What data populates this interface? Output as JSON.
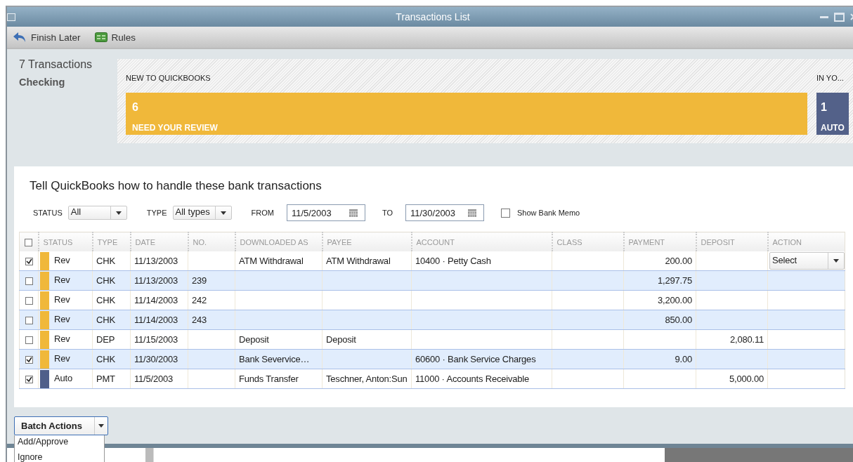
{
  "window": {
    "title": "Transactions List"
  },
  "toolbar": [
    {
      "kind": "back",
      "label": "Finish Later"
    },
    {
      "kind": "rules",
      "label": "Rules"
    }
  ],
  "summary": {
    "count": "7 Transactions",
    "account": "Checking",
    "new_heading": "NEW TO QUICKBOOKS",
    "review_count": "6",
    "review_label": "NEED YOUR REVIEW",
    "in_heading": "IN YO...",
    "auto_count": "1",
    "auto_label": "AUTO"
  },
  "panel": {
    "heading": "Tell QuickBooks how to handle these bank transactions",
    "filters": {
      "status_label": "STATUS",
      "status_value": "All",
      "type_label": "TYPE",
      "type_value": "All types",
      "from_label": "FROM",
      "from_value": "11/5/2003",
      "to_label": "TO",
      "to_value": "11/30/2003",
      "memo_label": "Show Bank Memo",
      "memo_checked": false
    }
  },
  "table": {
    "all_checked": false,
    "columns": [
      "STATUS",
      "TYPE",
      "DATE",
      "NO.",
      "DOWNLOADED AS",
      "PAYEE",
      "ACCOUNT",
      "CLASS",
      "PAYMENT",
      "DEPOSIT",
      "ACTION"
    ],
    "rows": [
      {
        "checked": true,
        "color": "#f0b83a",
        "status": "Rev",
        "type": "CHK",
        "date": "11/13/2003",
        "no": "",
        "downloaded_as": "ATM Withdrawal",
        "payee": "ATM Withdrawal",
        "account": "10400 · Petty Cash",
        "class": "",
        "payment": "200.00",
        "deposit": "",
        "action": "Select"
      },
      {
        "checked": false,
        "color": "#f0b83a",
        "status": "Rev",
        "type": "CHK",
        "date": "11/13/2003",
        "no": "239",
        "downloaded_as": "",
        "payee": "",
        "account": "",
        "class": "",
        "payment": "1,297.75",
        "deposit": "",
        "action": ""
      },
      {
        "checked": false,
        "color": "#f0b83a",
        "status": "Rev",
        "type": "CHK",
        "date": "11/14/2003",
        "no": "242",
        "downloaded_as": "",
        "payee": "",
        "account": "",
        "class": "",
        "payment": "3,200.00",
        "deposit": "",
        "action": ""
      },
      {
        "checked": false,
        "color": "#f0b83a",
        "status": "Rev",
        "type": "CHK",
        "date": "11/14/2003",
        "no": "243",
        "downloaded_as": "",
        "payee": "",
        "account": "",
        "class": "",
        "payment": "850.00",
        "deposit": "",
        "action": ""
      },
      {
        "checked": false,
        "color": "#f0b83a",
        "status": "Rev",
        "type": "DEP",
        "date": "11/15/2003",
        "no": "",
        "downloaded_as": "Deposit",
        "payee": "Deposit",
        "account": "",
        "class": "",
        "payment": "",
        "deposit": "2,080.11",
        "action": ""
      },
      {
        "checked": true,
        "color": "#f0b83a",
        "status": "Rev",
        "type": "CHK",
        "date": "11/30/2003",
        "no": "",
        "downloaded_as": "Bank Severvice…",
        "payee": "",
        "account": "60600 · Bank Service Charges",
        "class": "",
        "payment": "9.00",
        "deposit": "",
        "action": ""
      },
      {
        "checked": true,
        "color": "#4f5f8a",
        "status": "Auto",
        "type": "PMT",
        "date": "11/5/2003",
        "no": "",
        "downloaded_as": "Funds Transfer",
        "payee": "Teschner, Anton:Sun",
        "account": "11000 · Accounts Receivable",
        "class": "",
        "payment": "",
        "deposit": "5,000.00",
        "action": ""
      }
    ]
  },
  "batch": {
    "label": "Batch Actions",
    "menu": [
      "Add/Approve",
      "Ignore"
    ]
  }
}
